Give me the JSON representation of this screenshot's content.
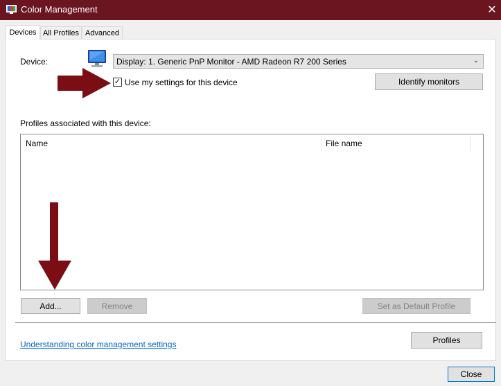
{
  "window": {
    "title": "Color Management",
    "close_glyph": "✕"
  },
  "tabs": [
    {
      "label": "Devices",
      "active": true
    },
    {
      "label": "All Profiles",
      "active": false
    },
    {
      "label": "Advanced",
      "active": false
    }
  ],
  "device": {
    "label": "Device:",
    "selected": "Display: 1. Generic PnP Monitor - AMD Radeon R7 200 Series",
    "use_my_settings_label": "Use my settings for this device",
    "use_my_settings_checked": true,
    "identify_button": "Identify monitors"
  },
  "profiles": {
    "section_label": "Profiles associated with this device:",
    "columns": [
      "Name",
      "File name"
    ],
    "rows": []
  },
  "buttons": {
    "add": "Add...",
    "remove": "Remove",
    "set_default": "Set as Default Profile",
    "profiles": "Profiles",
    "close": "Close"
  },
  "footer": {
    "link": "Understanding color management settings"
  },
  "annotations": {
    "arrow_color": "#7a0e14"
  },
  "colors": {
    "titlebar": "#6b1520",
    "link": "#0066cc"
  }
}
